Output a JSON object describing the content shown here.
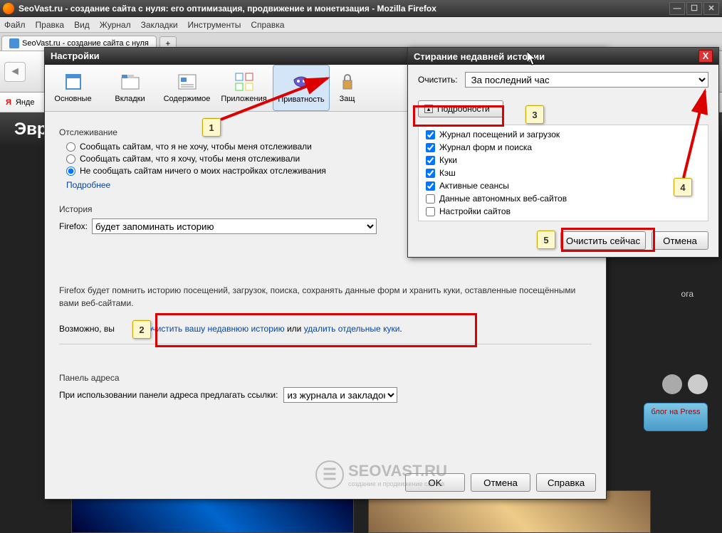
{
  "window": {
    "title": "SeoVast.ru - создание сайта с нуля: его оптимизация, продвижение и монетизация - Mozilla Firefox"
  },
  "menubar": [
    "Файл",
    "Правка",
    "Вид",
    "Журнал",
    "Закладки",
    "Инструменты",
    "Справка"
  ],
  "tab": {
    "title": "SeoVast.ru - создание сайта с нуля"
  },
  "yandex": {
    "label": "Янде"
  },
  "page": {
    "header": "Эвр",
    "blog": "блог на\nPress",
    "rightlabel": "ога"
  },
  "settings": {
    "title": "Настройки",
    "tabs": [
      "Основные",
      "Вкладки",
      "Содержимое",
      "Приложения",
      "Приватность",
      "Защ"
    ],
    "tracking_label": "Отслеживание",
    "radios": [
      "Сообщать сайтам, что я не хочу, чтобы меня отслеживали",
      "Сообщать сайтам, что я хочу, чтобы меня отслеживали",
      "Не сообщать сайтам ничего о моих настройках отслеживания"
    ],
    "more": "Подробнее",
    "history_label": "История",
    "history_prefix": "Firefox:",
    "history_select": "будет запоминать историю",
    "desc1": "Firefox будет помнить историю посещений, загрузок, поиска, сохранять данные форм и хранить куки, оставленные посещёнными вами веб-сайтами.",
    "desc2_prefix": "Возможно, вы",
    "desc2_mid": "те",
    "desc2_link1": "очистить вашу недавнюю историю",
    "desc2_or": " или ",
    "desc2_link2": "удалить отдельные куки",
    "addr_label": "Панель адреса",
    "addr_prefix": "При использовании панели адреса предлагать ссылки:",
    "addr_select": "из журнала и закладок",
    "buttons": {
      "ok": "OK",
      "cancel": "Отмена",
      "help": "Справка"
    }
  },
  "clearhist": {
    "title": "Стирание недавней истории",
    "clear_label": "Очистить:",
    "clear_select": "За последний час",
    "details": "Подробности",
    "items": [
      {
        "label": "Журнал посещений и загрузок",
        "checked": true
      },
      {
        "label": "Журнал форм и поиска",
        "checked": true
      },
      {
        "label": "Куки",
        "checked": true
      },
      {
        "label": "Кэш",
        "checked": true
      },
      {
        "label": "Активные сеансы",
        "checked": true
      },
      {
        "label": "Данные автономных веб-сайтов",
        "checked": false
      },
      {
        "label": "Настройки сайтов",
        "checked": false
      }
    ],
    "buttons": {
      "clear": "Очистить сейчас",
      "cancel": "Отмена"
    }
  },
  "callouts": {
    "1": "1",
    "2": "2",
    "3": "3",
    "4": "4",
    "5": "5"
  },
  "watermark": {
    "text": "SEOVAST.RU",
    "sub": "создание и продвижение сайтов"
  }
}
